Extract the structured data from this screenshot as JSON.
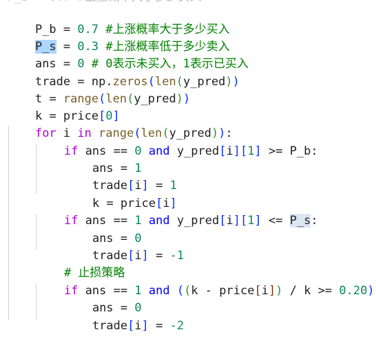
{
  "lines": [
    "P_b = 0.7 #上涨概率大于多少买入",
    "P_s = 0.3 #上涨概率低于多少卖入",
    "ans = 0 # 0表示未买入，1表示已买入",
    "trade = np.zeros(len(y_pred))",
    "t = range(len(y_pred))",
    "k = price[0]",
    "for i in range(len(y_pred)):",
    "if ans == 0 and y_pred[i][1] >= P_b:",
    "ans = 1",
    "trade[i] = 1",
    "k = price[i]",
    "if ans == 1 and y_pred[i][1] <= P_s:",
    "ans = 0",
    "trade[i] = -1",
    "# 止损策略",
    "if ans == 1 and ((k - price[i]) / k >= 0.20):",
    "ans = 0",
    "trade[i] = -2"
  ],
  "tokens": {
    "l0": [
      "P_b",
      " = ",
      "0.7",
      " #上涨概率大于多少买入"
    ],
    "l1": [
      "P_s",
      " = ",
      "0.3",
      " #上涨概率低于多少卖入"
    ],
    "l2": [
      "ans",
      " = ",
      "0",
      " # 0表示未买入，1表示已买入"
    ],
    "l3": [
      "trade",
      " = ",
      "np",
      ".",
      "zeros",
      "(",
      "len",
      "(",
      "y_pred",
      ")",
      ")"
    ],
    "l4": [
      "t",
      " = ",
      "range",
      "(",
      "len",
      "(",
      "y_pred",
      ")",
      ")"
    ],
    "l5": [
      "k",
      " = ",
      "price",
      "[",
      "0",
      "]"
    ],
    "l6": [
      "for",
      " ",
      "i",
      " ",
      "in",
      " ",
      "range",
      "(",
      "len",
      "(",
      "y_pred",
      ")",
      ")",
      ":"
    ],
    "l7": [
      "if",
      " ",
      "ans",
      " == ",
      "0",
      " ",
      "and",
      " ",
      "y_pred",
      "[",
      "i",
      "]",
      "[",
      "1",
      "]",
      " >= ",
      "P_b",
      ":"
    ],
    "l8": [
      "ans",
      " = ",
      "1"
    ],
    "l9": [
      "trade",
      "[",
      "i",
      "]",
      " = ",
      "1"
    ],
    "l10": [
      "k",
      " = ",
      "price",
      "[",
      "i",
      "]"
    ],
    "l11": [
      "if",
      " ",
      "ans",
      " == ",
      "1",
      " ",
      "and",
      " ",
      "y_pred",
      "[",
      "i",
      "]",
      "[",
      "1",
      "]",
      " <= ",
      "P_s",
      ":"
    ],
    "l12": [
      "ans",
      " = ",
      "0"
    ],
    "l13": [
      "trade",
      "[",
      "i",
      "]",
      " = ",
      "-1"
    ],
    "l14": [
      "# 止损策略"
    ],
    "l15": [
      "if",
      " ",
      "ans",
      " == ",
      "1",
      " ",
      "and",
      " ",
      "(",
      "(",
      "k",
      " - ",
      "price",
      "[",
      "i",
      "]",
      ")",
      " / ",
      "k",
      " >= ",
      "0.20",
      ")",
      ":"
    ],
    "l16": [
      "ans",
      " = ",
      "0"
    ],
    "l17": [
      "trade",
      "[",
      "i",
      "]",
      " = ",
      "-2"
    ]
  },
  "colors": {
    "keyword": "#0000ff",
    "control": "#af00db",
    "number": "#098658",
    "comment": "#008000",
    "function": "#795e26",
    "selection": "#add6ff",
    "selection_secondary": "#dde7f4"
  }
}
